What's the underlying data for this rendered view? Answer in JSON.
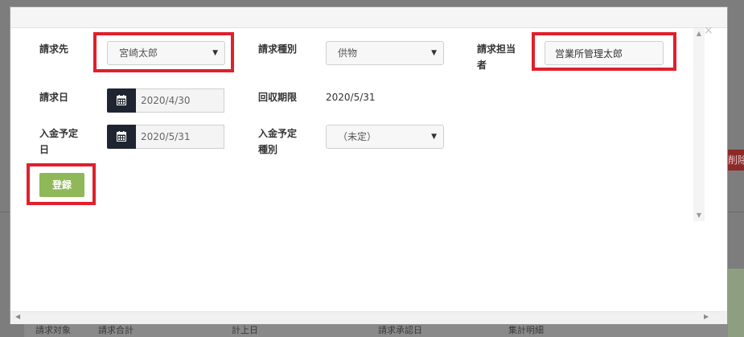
{
  "background": {
    "delete_button": "削除",
    "table_headers": [
      "請求対象",
      "請求合計",
      "計上日",
      "請求承認日",
      "集計明細"
    ]
  },
  "modal": {
    "close_symbol": "×",
    "fields": {
      "billing_to": {
        "label": "請求先",
        "value": "宮崎太郎"
      },
      "billing_type": {
        "label": "請求種別",
        "value": "供物"
      },
      "billing_staff": {
        "label": "請求担当者",
        "value": "営業所管理太郎"
      },
      "billing_date": {
        "label": "請求日",
        "value": "2020/4/30"
      },
      "collection_deadline": {
        "label": "回収期限",
        "value": "2020/5/31"
      },
      "payment_date": {
        "label": "入金予定日",
        "value": "2020/5/31"
      },
      "payment_type": {
        "label": "入金予定種別",
        "value": "（未定）"
      }
    },
    "register_button": "登録"
  },
  "colors": {
    "highlight": "#e0202c",
    "register_button": "#8fb858",
    "calendar_button": "#1f2530"
  }
}
